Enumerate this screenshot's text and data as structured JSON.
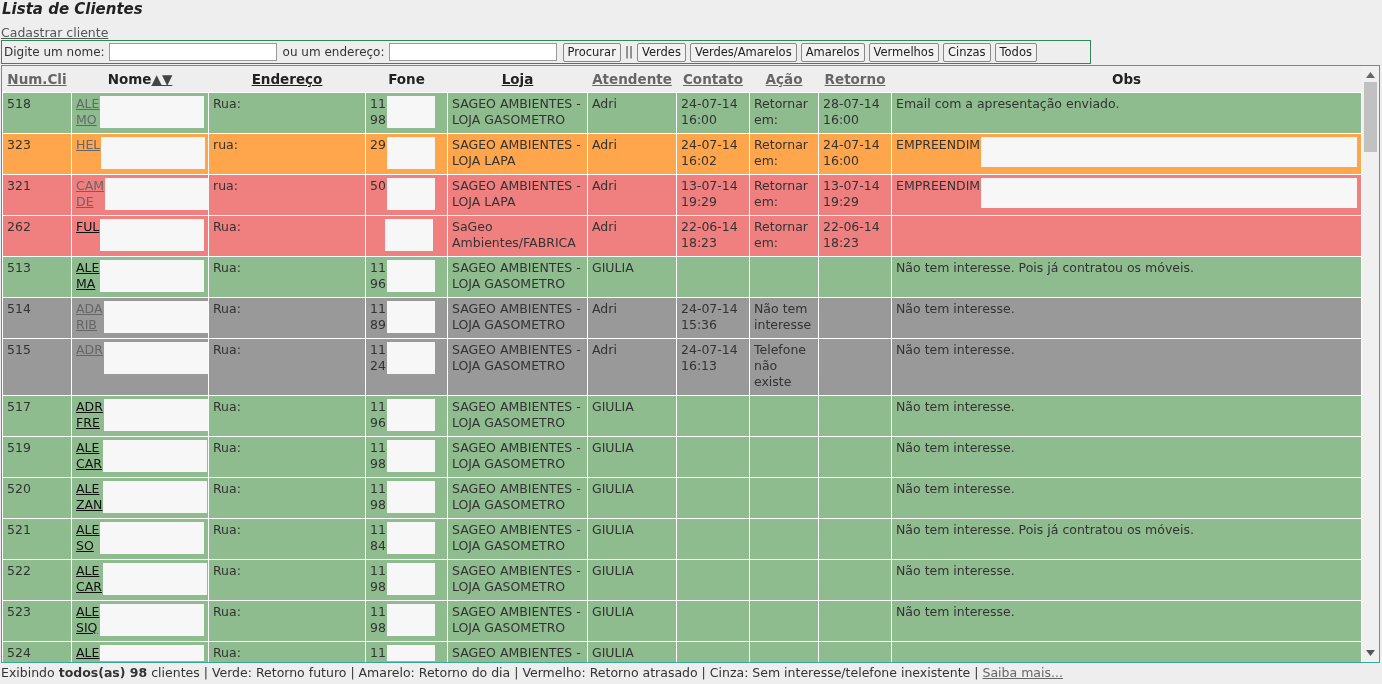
{
  "title": "Lista de Clientes",
  "register_link": "Cadastrar cliente",
  "search": {
    "name_label": "Digite um nome:",
    "address_label": "ou um endereço:",
    "button": "Procurar",
    "separator": "||"
  },
  "filters": [
    "Verdes",
    "Verdes/Amarelos",
    "Amarelos",
    "Vermelhos",
    "Cinzas",
    "Todos"
  ],
  "table": {
    "columns": [
      {
        "label": "Num.Cli",
        "link": true,
        "visited": true
      },
      {
        "label": "Nome",
        "link": false,
        "visited": false,
        "sort": "▲▼"
      },
      {
        "label": "Endereço",
        "link": true,
        "visited": false
      },
      {
        "label": "Fone",
        "link": false,
        "visited": false
      },
      {
        "label": "Loja",
        "link": true,
        "visited": false
      },
      {
        "label": "Atendente",
        "link": true,
        "visited": true
      },
      {
        "label": "Contato",
        "link": true,
        "visited": true
      },
      {
        "label": "Ação",
        "link": true,
        "visited": true
      },
      {
        "label": "Retorno",
        "link": true,
        "visited": true
      },
      {
        "label": "Obs",
        "link": false,
        "visited": false
      }
    ],
    "rows": [
      {
        "color": "#8fbc8f",
        "num": "518",
        "name": [
          "ALE",
          "MO"
        ],
        "visited": true,
        "address": "Rua:",
        "phone": [
          "11",
          "98"
        ],
        "store": "SAGEO AMBIENTES - LOJA GASOMETRO",
        "agent": "Adri",
        "contact": "24-07-14 16:00",
        "action": "Retornar em:",
        "return": "28-07-14 16:00",
        "obs": "Email com a apresentação enviado.",
        "obs_redacted": false
      },
      {
        "color": "#ffa64d",
        "num": "323",
        "name": [
          "HEL"
        ],
        "visited": true,
        "address": "rua:",
        "phone": [
          "29"
        ],
        "store": "SAGEO AMBIENTES - LOJA LAPA",
        "agent": "Adri",
        "contact": "24-07-14 16:02",
        "action": "Retornar em:",
        "return": "24-07-14 16:00",
        "obs": "EMPREENDIM",
        "obs_redacted": true
      },
      {
        "color": "#f08080",
        "num": "321",
        "name": [
          "CAM",
          "DE"
        ],
        "visited": true,
        "address": "rua:",
        "phone": [
          "50"
        ],
        "store": "SAGEO AMBIENTES - LOJA LAPA",
        "agent": "Adri",
        "contact": "13-07-14 19:29",
        "action": "Retornar em:",
        "return": "13-07-14 19:29",
        "obs": "EMPREENDIM",
        "obs_redacted": true
      },
      {
        "color": "#f08080",
        "num": "262",
        "name": [
          "FUL"
        ],
        "visited": false,
        "address": "Rua:",
        "store": "SaGeo Ambientes/FABRICA",
        "agent": "Adri",
        "contact": "22-06-14 18:23",
        "action": "Retornar em:",
        "return": "22-06-14 18:23"
      },
      {
        "color": "#8fbc8f",
        "num": "513",
        "name": [
          "ALE",
          "MA"
        ],
        "visited": false,
        "address": "Rua:",
        "phone": [
          "11",
          "96"
        ],
        "store": "SAGEO AMBIENTES - LOJA GASOMETRO",
        "agent": "GIULIA",
        "obs": "Não tem interesse. Pois já contratou os móveis.",
        "obs_redacted": false
      },
      {
        "color": "#999999",
        "num": "514",
        "name": [
          "ADA",
          "RIB"
        ],
        "visited": true,
        "address": "Rua:",
        "phone": [
          "11",
          "89"
        ],
        "store": "SAGEO AMBIENTES - LOJA GASOMETRO",
        "agent": "Adri",
        "contact": "24-07-14 15:36",
        "action": "Não tem interesse",
        "obs": "Não tem interesse.",
        "obs_redacted": false
      },
      {
        "color": "#999999",
        "num": "515",
        "name": [
          "ADR"
        ],
        "visited": true,
        "address": "Rua:",
        "phone": [
          "11",
          "24"
        ],
        "store": "SAGEO AMBIENTES - LOJA GASOMETRO",
        "agent": "Adri",
        "contact": "24-07-14 16:13",
        "action": "Telefone não existe",
        "obs": "Não tem interesse.",
        "obs_redacted": false
      },
      {
        "color": "#8fbc8f",
        "num": "517",
        "name": [
          "ADR",
          "FRE"
        ],
        "visited": false,
        "address": "Rua:",
        "phone": [
          "11",
          "96"
        ],
        "store": "SAGEO AMBIENTES - LOJA GASOMETRO",
        "agent": "GIULIA",
        "obs": "Não tem interesse.",
        "obs_redacted": false
      },
      {
        "color": "#8fbc8f",
        "num": "519",
        "name": [
          "ALE",
          "CAR"
        ],
        "visited": false,
        "address": "Rua:",
        "phone": [
          "11",
          "98"
        ],
        "store": "SAGEO AMBIENTES - LOJA GASOMETRO",
        "agent": "GIULIA",
        "obs": "Não tem interesse.",
        "obs_redacted": false
      },
      {
        "color": "#8fbc8f",
        "num": "520",
        "name": [
          "ALE",
          "ZAN"
        ],
        "visited": false,
        "address": "Rua:",
        "phone": [
          "11",
          "98"
        ],
        "store": "SAGEO AMBIENTES - LOJA GASOMETRO",
        "agent": "GIULIA",
        "obs": "Não tem interesse.",
        "obs_redacted": false
      },
      {
        "color": "#8fbc8f",
        "num": "521",
        "name": [
          "ALE",
          "SO"
        ],
        "visited": false,
        "address": "Rua:",
        "phone": [
          "11",
          "84"
        ],
        "store": "SAGEO AMBIENTES - LOJA GASOMETRO",
        "agent": "GIULIA",
        "obs": "Não tem interesse. Pois já contratou os móveis.",
        "obs_redacted": false
      },
      {
        "color": "#8fbc8f",
        "num": "522",
        "name": [
          "ALE",
          "CAR"
        ],
        "visited": false,
        "address": "Rua:",
        "phone": [
          "11",
          "98"
        ],
        "store": "SAGEO AMBIENTES - LOJA GASOMETRO",
        "agent": "GIULIA",
        "obs": "Não tem interesse.",
        "obs_redacted": false
      },
      {
        "color": "#8fbc8f",
        "num": "523",
        "name": [
          "ALE",
          "SIQ"
        ],
        "visited": false,
        "address": "Rua:",
        "phone": [
          "11",
          "98"
        ],
        "store": "SAGEO AMBIENTES - LOJA GASOMETRO",
        "agent": "GIULIA",
        "obs": "Não tem interesse.",
        "obs_redacted": false
      },
      {
        "color": "#8fbc8f",
        "num": "524",
        "name": [
          "ALE"
        ],
        "visited": false,
        "address": "Rua:",
        "phone": [
          "11"
        ],
        "store": "SAGEO AMBIENTES -",
        "agent": "GIULIA"
      }
    ]
  },
  "footer": {
    "text": "Exibindo **todos(as) 98** clientes | Verde: Retorno futuro | Amarelo: Retorno do dia | Vermelho: Retorno atrasado | Cinza: Sem interesse/telefone inexistente |",
    "link": "Saiba mais..."
  }
}
